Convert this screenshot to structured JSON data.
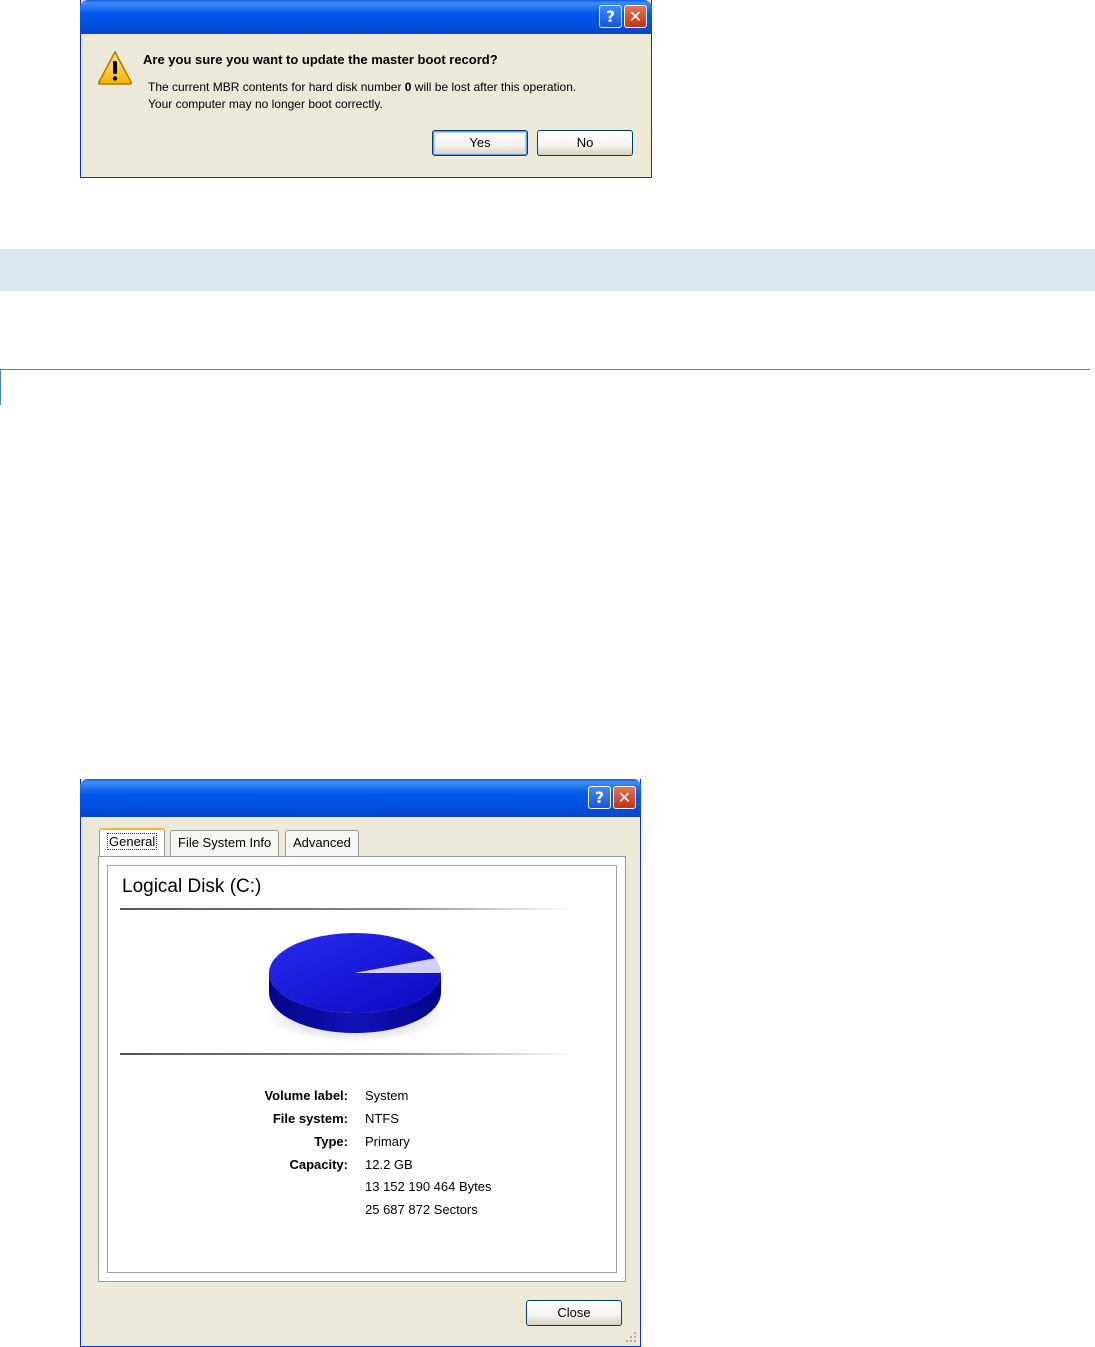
{
  "mbr_dialog": {
    "help_glyph": "?",
    "close_glyph": "✕",
    "question": "Are you sure you want to update the master boot record?",
    "message_line1_pre": "The current MBR contents for hard disk number ",
    "disk_number": "0",
    "message_line1_post": " will be lost after this operation.",
    "message_line2": "Your computer may no longer boot correctly.",
    "yes_label": "Yes",
    "no_label": "No"
  },
  "properties_dialog": {
    "help_glyph": "?",
    "close_glyph": "✕",
    "tabs": [
      {
        "label": "General",
        "active": true
      },
      {
        "label": "File System Info",
        "active": false
      },
      {
        "label": "Advanced",
        "active": false
      }
    ],
    "disk_title": "Logical Disk (C:)",
    "pie": {
      "used_fraction": 0.94,
      "free_fraction": 0.06,
      "used_color": "#1010c8",
      "free_color": "#c8c8f8"
    },
    "properties": {
      "volume_label_label": "Volume label:",
      "volume_label": "System",
      "file_system_label": "File system:",
      "file_system": "NTFS",
      "type_label": "Type:",
      "type": "Primary",
      "capacity_label": "Capacity:",
      "capacity": "12.2 GB",
      "capacity_bytes": "13 152 190 464 Bytes",
      "capacity_sectors": "25 687 872 Sectors"
    },
    "close_label": "Close"
  },
  "colors": {
    "title_blue": "#0058ee",
    "dialog_bg": "#ece9d8",
    "band": "#dce6f1",
    "rule": "#4f81bd"
  }
}
